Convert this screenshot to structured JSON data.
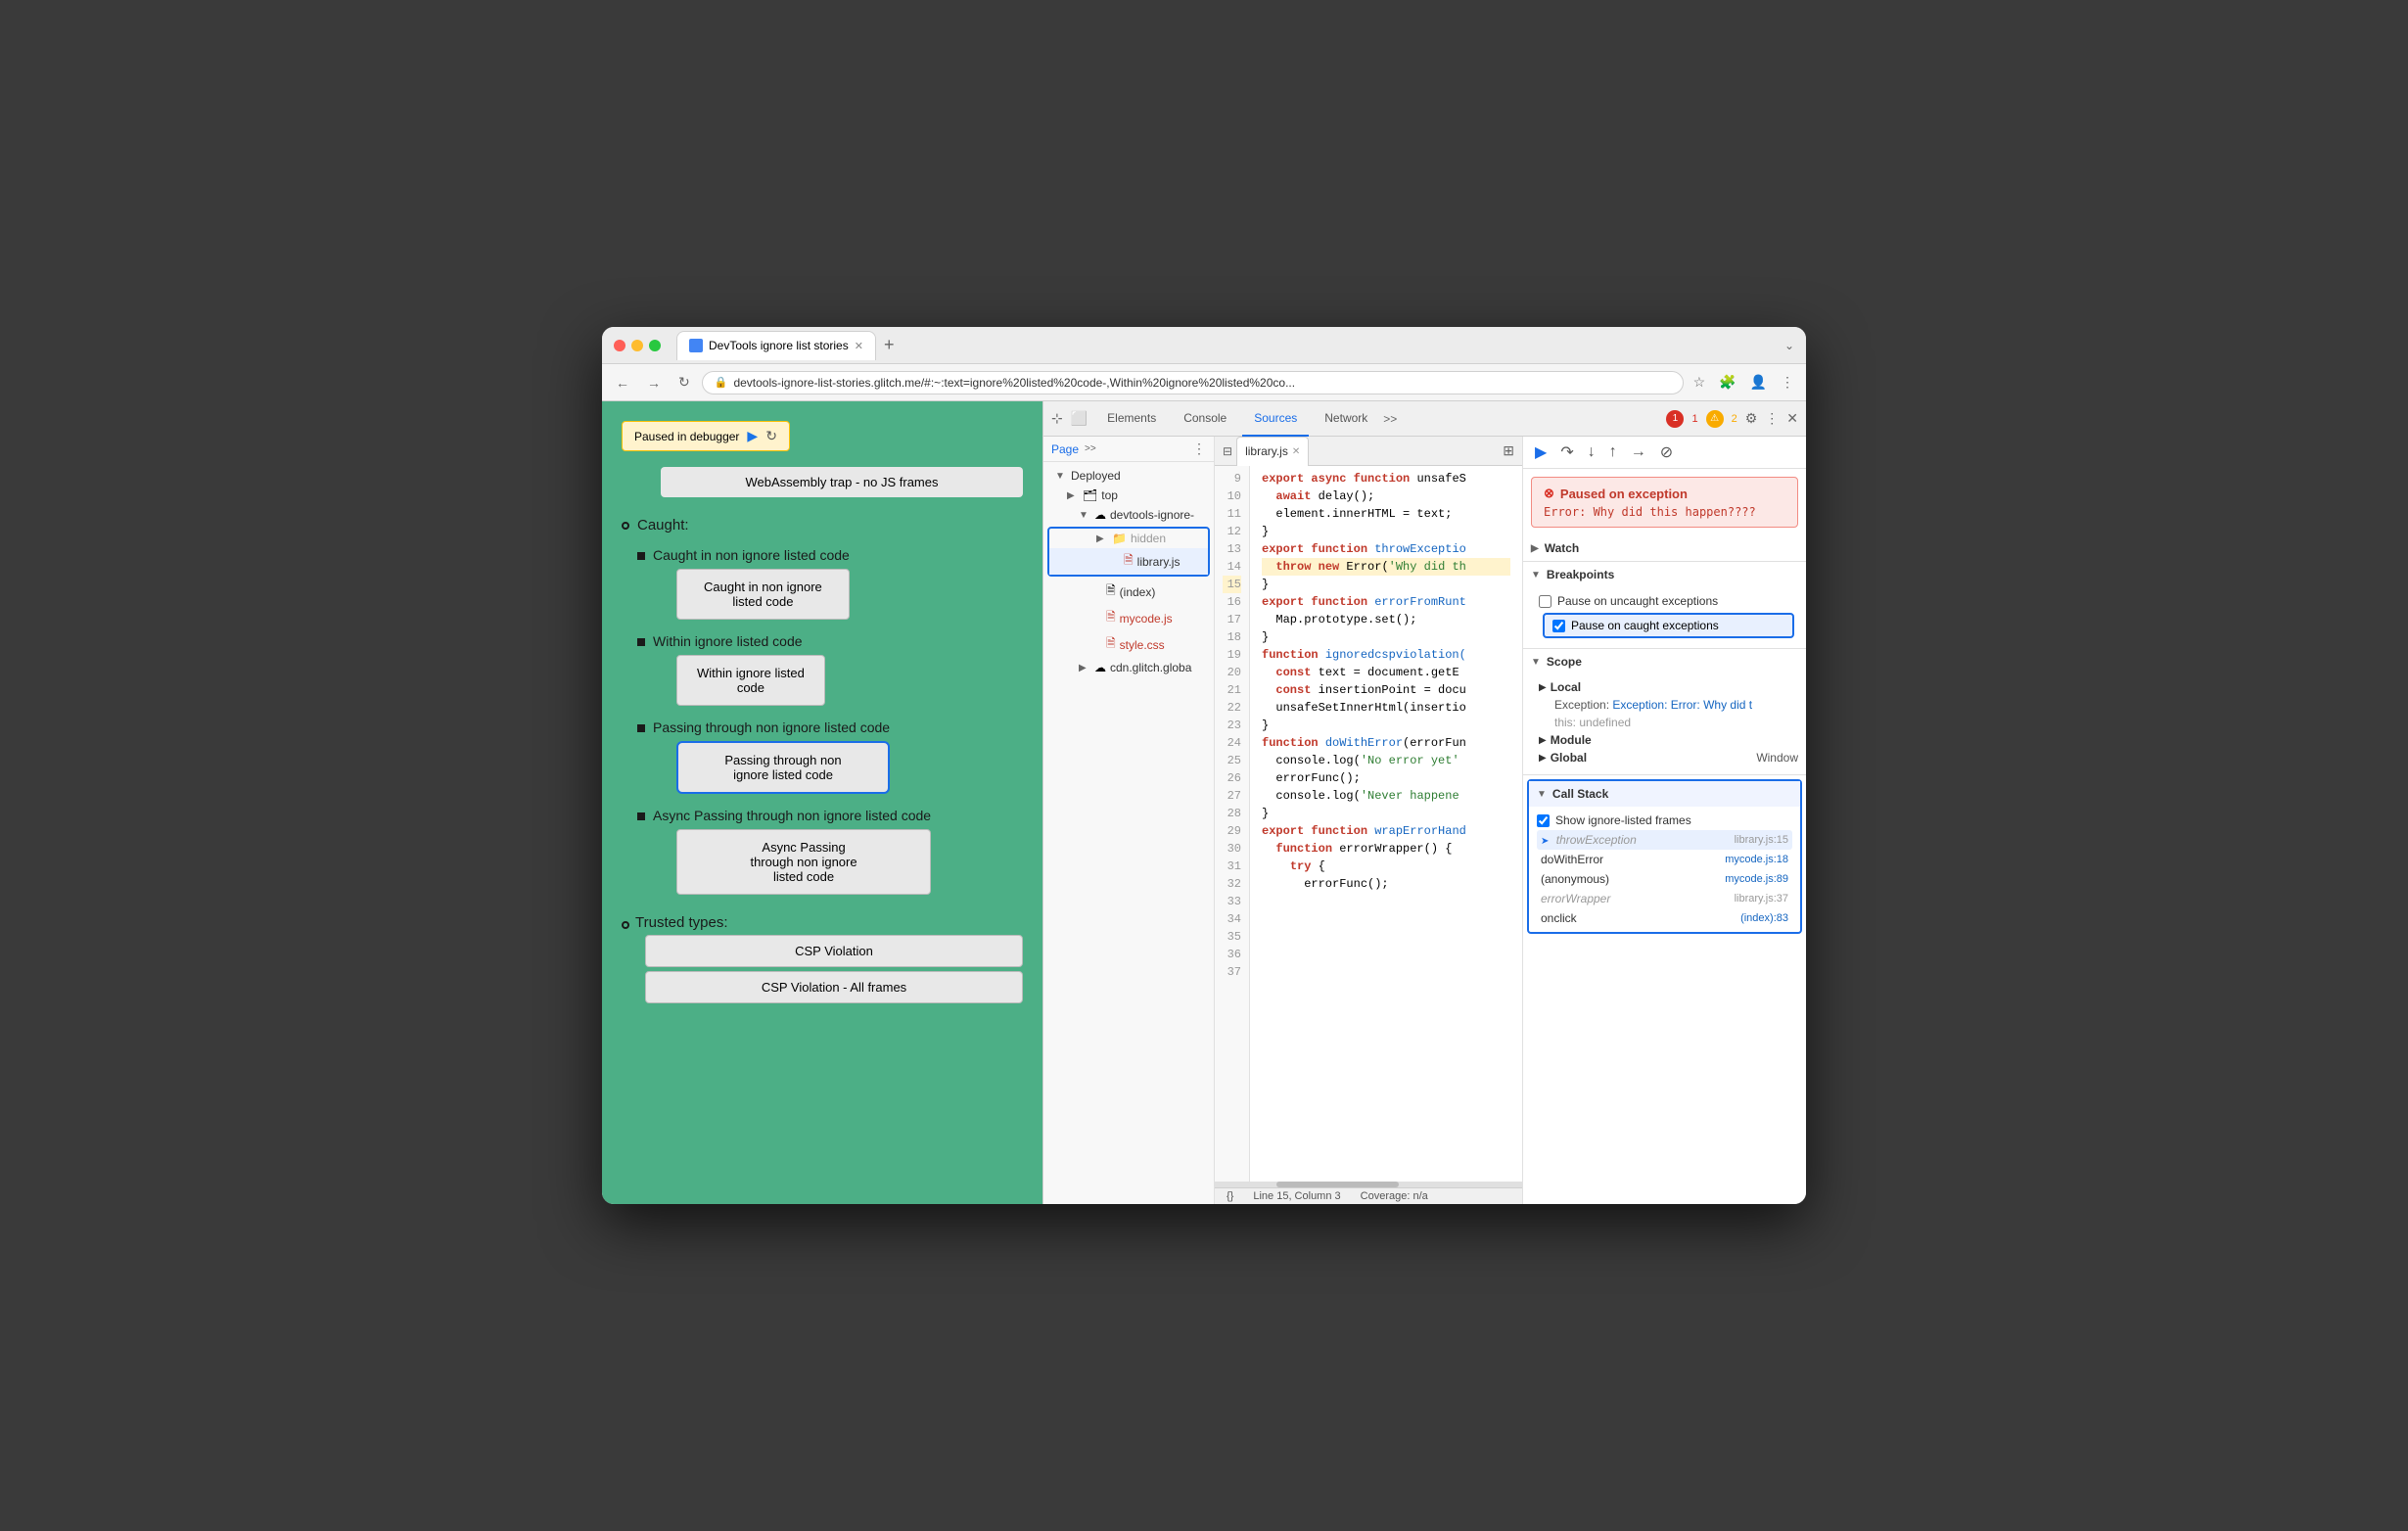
{
  "window": {
    "title": "DevTools ignore list stories"
  },
  "browser": {
    "url": "devtools-ignore-list-stories.glitch.me/#:~:text=ignore%20listed%20code-,Within%20ignore%20listed%20co...",
    "tab_label": "DevTools ignore list stories",
    "new_tab_icon": "+"
  },
  "webpage": {
    "debugger_banner": "Paused in debugger",
    "webassembly_box": "WebAssembly trap - no JS frames",
    "caught_label": "Caught:",
    "items": [
      {
        "label": "Caught in non ignore listed code",
        "has_button": true,
        "button_text": "Caught in non ignore\nlisted code",
        "active": false
      },
      {
        "label": "Within ignore listed code",
        "has_button": true,
        "button_text": "Within ignore listed\ncode",
        "active": false
      },
      {
        "label": "Passing through non ignore listed code",
        "has_button": true,
        "button_text": "Passing through non\nignore listed code",
        "active": true
      },
      {
        "label": "Async Passing through non ignore listed code",
        "has_button": true,
        "button_text": "Async Passing\nthrough non ignore\nlisted code",
        "active": false
      }
    ],
    "trusted_types_label": "Trusted types:",
    "csp_buttons": [
      "CSP Violation",
      "CSP Violation - All frames"
    ]
  },
  "devtools": {
    "tabs": [
      "Elements",
      "Console",
      "Sources",
      "Network"
    ],
    "active_tab": "Sources",
    "error_count": "1",
    "warning_count": "2",
    "file_tab": "library.js",
    "toolbar": {
      "play": "▶",
      "step_over": "↷",
      "step_into": "↓",
      "step_out": "↑",
      "step": "→",
      "deactivate": "⊘"
    }
  },
  "file_tree": {
    "page_label": "Page",
    "items": [
      {
        "label": "Deployed",
        "type": "group",
        "indent": 0
      },
      {
        "label": "top",
        "type": "folder",
        "indent": 1
      },
      {
        "label": "devtools-ignore-",
        "type": "cloud-folder",
        "indent": 2,
        "expanded": true
      },
      {
        "label": "hidden",
        "type": "folder-highlighted",
        "indent": 3,
        "in_box": true
      },
      {
        "label": "library.js",
        "type": "file-red",
        "indent": 4,
        "selected": true,
        "in_box": true
      },
      {
        "label": "(index)",
        "type": "file",
        "indent": 3
      },
      {
        "label": "mycode.js",
        "type": "file-red",
        "indent": 3
      },
      {
        "label": "style.css",
        "type": "file-red",
        "indent": 3
      },
      {
        "label": "cdn.glitch.globa",
        "type": "cloud-folder",
        "indent": 2
      }
    ]
  },
  "code": {
    "status_line": "Line 15, Column 3",
    "status_coverage": "Coverage: n/a",
    "lines": [
      {
        "num": 9,
        "text": "export async function unsafeS",
        "highlight": false
      },
      {
        "num": 10,
        "text": "  await delay();",
        "highlight": false
      },
      {
        "num": 11,
        "text": "  element.innerHTML = text;",
        "highlight": false
      },
      {
        "num": 12,
        "text": "}",
        "highlight": false
      },
      {
        "num": 13,
        "text": "",
        "highlight": false
      },
      {
        "num": 14,
        "text": "export function throwExceptio",
        "highlight": false
      },
      {
        "num": 15,
        "text": "  throw new Error('Why did th",
        "highlight": true
      },
      {
        "num": 16,
        "text": "}",
        "highlight": false
      },
      {
        "num": 17,
        "text": "",
        "highlight": false
      },
      {
        "num": 18,
        "text": "export function errorFromRunt",
        "highlight": false
      },
      {
        "num": 19,
        "text": "  Map.prototype.set();",
        "highlight": false
      },
      {
        "num": 20,
        "text": "}",
        "highlight": false
      },
      {
        "num": 21,
        "text": "",
        "highlight": false
      },
      {
        "num": 22,
        "text": "function ignoredcspviolation(",
        "highlight": false
      },
      {
        "num": 23,
        "text": "  const text = document.getE",
        "highlight": false
      },
      {
        "num": 24,
        "text": "  const insertionPoint = docu",
        "highlight": false
      },
      {
        "num": 25,
        "text": "  unsafeSetInnerHtml(insertio",
        "highlight": false
      },
      {
        "num": 26,
        "text": "}",
        "highlight": false
      },
      {
        "num": 27,
        "text": "",
        "highlight": false
      },
      {
        "num": 28,
        "text": "function doWithError(errorFun",
        "highlight": false
      },
      {
        "num": 29,
        "text": "  console.log('No error yet'",
        "highlight": false
      },
      {
        "num": 30,
        "text": "  errorFunc();",
        "highlight": false
      },
      {
        "num": 31,
        "text": "  console.log('Never happene",
        "highlight": false
      },
      {
        "num": 32,
        "text": "}",
        "highlight": false
      },
      {
        "num": 33,
        "text": "",
        "highlight": false
      },
      {
        "num": 34,
        "text": "export function wrapErrorHand",
        "highlight": false
      },
      {
        "num": 35,
        "text": "  function errorWrapper() {",
        "highlight": false
      },
      {
        "num": 36,
        "text": "    try {",
        "highlight": false
      },
      {
        "num": 37,
        "text": "      errorFunc();",
        "highlight": false
      }
    ]
  },
  "right_panel": {
    "exception": {
      "title": "Paused on exception",
      "error_text": "Error: Why did this happen????"
    },
    "watch_label": "Watch",
    "breakpoints_label": "Breakpoints",
    "pause_uncaught_label": "Pause on uncaught exceptions",
    "pause_caught_label": "Pause on caught exceptions",
    "pause_caught_checked": true,
    "pause_uncaught_checked": false,
    "scope_label": "Scope",
    "local_label": "Local",
    "local_exception": "Exception: Error: Why did t",
    "local_this": "this:  undefined",
    "module_label": "Module",
    "global_label": "Global",
    "global_value": "Window",
    "call_stack_label": "Call Stack",
    "show_ignored_label": "Show ignore-listed frames",
    "show_ignored_checked": true,
    "stack_frames": [
      {
        "name": "throwException",
        "loc": "library.js:15",
        "active": true,
        "dimmed": true,
        "has_icon": true
      },
      {
        "name": "doWithError",
        "loc": "mycode.js:18",
        "active": false,
        "dimmed": false,
        "has_icon": false
      },
      {
        "name": "(anonymous)",
        "loc": "mycode.js:89",
        "active": false,
        "dimmed": false,
        "has_icon": false
      },
      {
        "name": "errorWrapper",
        "loc": "library.js:37",
        "active": false,
        "dimmed": true,
        "has_icon": false
      },
      {
        "name": "onclick",
        "loc": "(index):83",
        "active": false,
        "dimmed": false,
        "has_icon": false
      }
    ]
  }
}
